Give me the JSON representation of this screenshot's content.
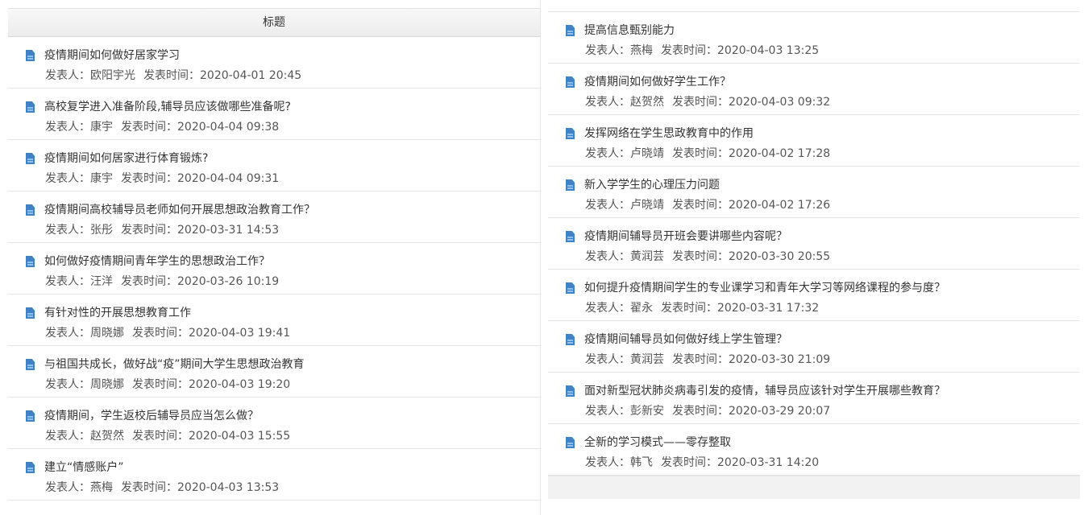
{
  "left_panel": {
    "header": "标题",
    "articles": [
      {
        "title": "疫情期间如何做好居家学习",
        "author_label": "发表人：",
        "author": "欧阳宇光",
        "time_label": "发表时间：",
        "time": "2020-04-01 20:45"
      },
      {
        "title": "高校复学进入准备阶段,辅导员应该做哪些准备呢?",
        "author_label": "发表人：",
        "author": "康宇",
        "time_label": "发表时间：",
        "time": "2020-04-04 09:38"
      },
      {
        "title": "疫情期间如何居家进行体育锻炼?",
        "author_label": "发表人：",
        "author": "康宇",
        "time_label": "发表时间：",
        "time": "2020-04-04 09:31"
      },
      {
        "title": "疫情期间高校辅导员老师如何开展思想政治教育工作？",
        "author_label": "发表人：",
        "author": "张彤",
        "time_label": "发表时间：",
        "time": "2020-03-31 14:53"
      },
      {
        "title": "如何做好疫情期间青年学生的思想政治工作？",
        "author_label": "发表人：",
        "author": "汪洋",
        "time_label": "发表时间：",
        "time": "2020-03-26 10:19"
      },
      {
        "title": "有针对性的开展思想教育工作",
        "author_label": "发表人：",
        "author": "周晓娜",
        "time_label": "发表时间：",
        "time": "2020-04-03 19:41"
      },
      {
        "title": "与祖国共成长，做好战“疫”期间大学生思想政治教育",
        "author_label": "发表人：",
        "author": "周晓娜",
        "time_label": "发表时间：",
        "time": "2020-04-03 19:20"
      },
      {
        "title": "疫情期间，学生返校后辅导员应当怎么做？",
        "author_label": "发表人：",
        "author": "赵贺然",
        "time_label": "发表时间：",
        "time": "2020-04-03 15:55"
      },
      {
        "title": "建立“情感账户”",
        "author_label": "发表人：",
        "author": "燕梅",
        "time_label": "发表时间：",
        "time": "2020-04-03 13:53"
      }
    ]
  },
  "right_panel": {
    "articles": [
      {
        "title": "提高信息甄别能力",
        "author_label": "发表人：",
        "author": "燕梅",
        "time_label": "发表时间：",
        "time": "2020-04-03 13:25"
      },
      {
        "title": "疫情期间如何做好学生工作？",
        "author_label": "发表人：",
        "author": "赵贺然",
        "time_label": "发表时间：",
        "time": "2020-04-03 09:32"
      },
      {
        "title": "发挥网络在学生思政教育中的作用",
        "author_label": "发表人：",
        "author": "卢晓靖",
        "time_label": "发表时间：",
        "time": "2020-04-02 17:28"
      },
      {
        "title": "新入学学生的心理压力问题",
        "author_label": "发表人：",
        "author": "卢晓靖",
        "time_label": "发表时间：",
        "time": "2020-04-02 17:26"
      },
      {
        "title": "疫情期间辅导员开班会要讲哪些内容呢？",
        "author_label": "发表人：",
        "author": "黄润芸",
        "time_label": "发表时间：",
        "time": "2020-03-30 20:55"
      },
      {
        "title": "如何提升疫情期间学生的专业课学习和青年大学习等网络课程的参与度？",
        "author_label": "发表人：",
        "author": "翟永",
        "time_label": "发表时间：",
        "time": "2020-03-31 17:32"
      },
      {
        "title": "疫情期间辅导员如何做好线上学生管理？",
        "author_label": "发表人：",
        "author": "黄润芸",
        "time_label": "发表时间：",
        "time": "2020-03-30 21:09"
      },
      {
        "title": "面对新型冠状肺炎病毒引发的疫情，辅导员应该针对学生开展哪些教育？",
        "author_label": "发表人：",
        "author": "彭新安",
        "time_label": "发表时间：",
        "time": "2020-03-29 20:07"
      },
      {
        "title": "全新的学习模式——零存整取",
        "author_label": "发表人：",
        "author": "韩飞",
        "time_label": "发表时间：",
        "time": "2020-03-31 14:20"
      }
    ]
  },
  "colors": {
    "icon": "#3f82c6",
    "border": "#e6e6e6",
    "header_bg": "#efefef",
    "text": "#333333"
  },
  "icons": {
    "item_icon": "document-icon"
  }
}
